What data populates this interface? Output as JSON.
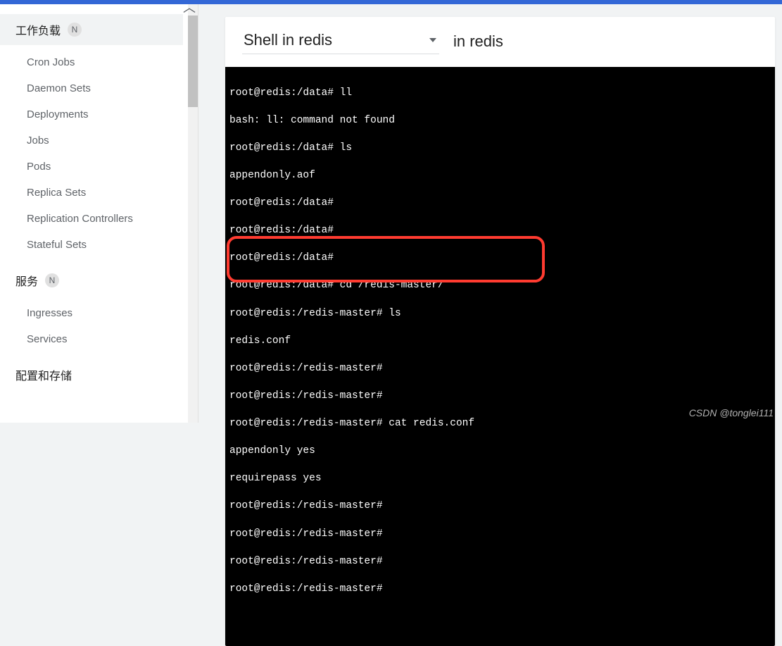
{
  "sidebar": {
    "sections": [
      {
        "label": "工作负载",
        "badge": "N",
        "items": [
          {
            "name": "cron-jobs",
            "label": "Cron Jobs"
          },
          {
            "name": "daemon-sets",
            "label": "Daemon Sets"
          },
          {
            "name": "deployments",
            "label": "Deployments"
          },
          {
            "name": "jobs",
            "label": "Jobs"
          },
          {
            "name": "pods",
            "label": "Pods"
          },
          {
            "name": "replica-sets",
            "label": "Replica Sets"
          },
          {
            "name": "replication-controllers",
            "label": "Replication Controllers"
          },
          {
            "name": "stateful-sets",
            "label": "Stateful Sets"
          }
        ]
      },
      {
        "label": "服务",
        "badge": "N",
        "items": [
          {
            "name": "ingresses",
            "label": "Ingresses"
          },
          {
            "name": "services",
            "label": "Services"
          }
        ]
      },
      {
        "label": "配置和存储",
        "badge": "",
        "items": []
      }
    ]
  },
  "shell": {
    "select_label": "Shell in redis",
    "in_label": "in redis"
  },
  "terminal": {
    "lines": [
      "root@redis:/data# ll",
      "bash: ll: command not found",
      "root@redis:/data# ls",
      "appendonly.aof",
      "root@redis:/data#",
      "root@redis:/data#",
      "root@redis:/data#",
      "root@redis:/data# cd /redis-master/",
      "root@redis:/redis-master# ls",
      "redis.conf",
      "root@redis:/redis-master#",
      "root@redis:/redis-master#",
      "root@redis:/redis-master# cat redis.conf",
      "appendonly yes",
      "requirepass yes",
      "root@redis:/redis-master#",
      "root@redis:/redis-master#",
      "root@redis:/redis-master#",
      "root@redis:/redis-master#"
    ]
  },
  "watermark": "CSDN @tonglei111"
}
